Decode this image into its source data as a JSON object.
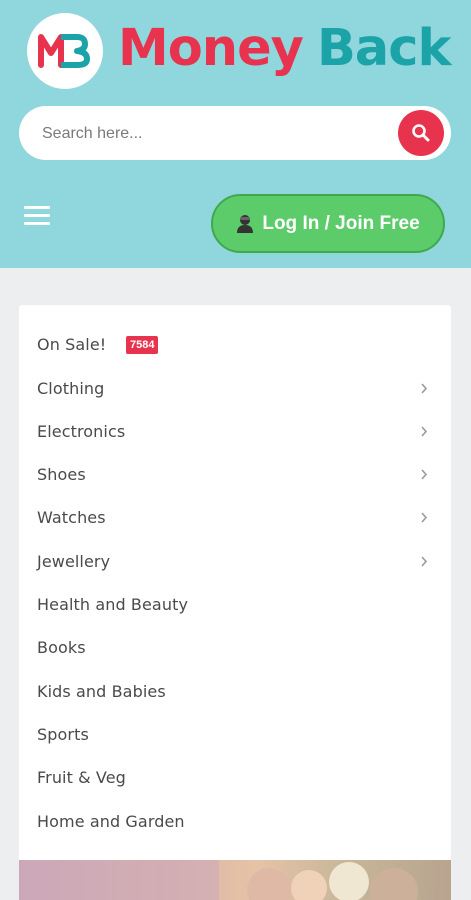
{
  "brand": {
    "logo_text": "MB",
    "name_part1": "Money",
    "name_part2": "Back"
  },
  "search": {
    "placeholder": "Search here..."
  },
  "header": {
    "login_label": "Log In / Join Free"
  },
  "categories": [
    {
      "label": "On Sale!",
      "badge": "7584",
      "has_submenu": false
    },
    {
      "label": "Clothing",
      "has_submenu": true
    },
    {
      "label": "Electronics",
      "has_submenu": true
    },
    {
      "label": "Shoes",
      "has_submenu": true
    },
    {
      "label": "Watches",
      "has_submenu": true
    },
    {
      "label": "Jewellery",
      "has_submenu": true
    },
    {
      "label": "Health and Beauty",
      "has_submenu": false
    },
    {
      "label": "Books",
      "has_submenu": false
    },
    {
      "label": "Kids and Babies",
      "has_submenu": false
    },
    {
      "label": "Sports",
      "has_submenu": false
    },
    {
      "label": "Fruit & Veg",
      "has_submenu": false
    },
    {
      "label": "Home and Garden",
      "has_submenu": false
    }
  ],
  "icons": {
    "search": "search-icon",
    "menu": "menu-icon",
    "user": "user-icon",
    "chevron": "chevron-right-icon"
  },
  "colors": {
    "header_bg": "#8fd6dd",
    "brand_red": "#e8334f",
    "brand_teal": "#1ba3a8",
    "login_green": "#5ccc6b"
  }
}
